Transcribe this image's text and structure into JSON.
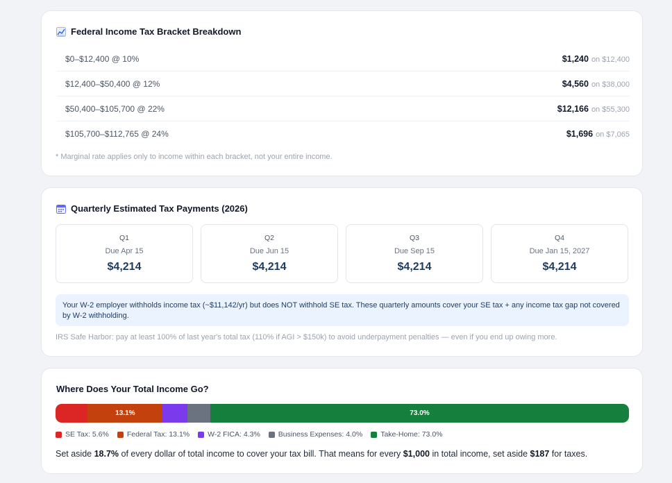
{
  "brackets": {
    "title": "Federal Income Tax Bracket Breakdown",
    "icon": "chart-icon",
    "rows": [
      {
        "range": "$0–$12,400 @ 10%",
        "tax": "$1,240",
        "on": "on $12,400"
      },
      {
        "range": "$12,400–$50,400 @ 12%",
        "tax": "$4,560",
        "on": "on $38,000"
      },
      {
        "range": "$50,400–$105,700 @ 22%",
        "tax": "$12,166",
        "on": "on $55,300"
      },
      {
        "range": "$105,700–$112,765 @ 24%",
        "tax": "$1,696",
        "on": "on $7,065"
      }
    ],
    "note": "* Marginal rate applies only to income within each bracket, not your entire income."
  },
  "quarterly": {
    "title": "Quarterly Estimated Tax Payments (2026)",
    "icon": "calendar-icon",
    "quarters": [
      {
        "label": "Q1",
        "due": "Due Apr 15",
        "amount": "$4,214"
      },
      {
        "label": "Q2",
        "due": "Due Jun 15",
        "amount": "$4,214"
      },
      {
        "label": "Q3",
        "due": "Due Sep 15",
        "amount": "$4,214"
      },
      {
        "label": "Q4",
        "due": "Due Jan 15, 2027",
        "amount": "$4,214"
      }
    ],
    "info": "Your W-2 employer withholds income tax (~$11,142/yr) but does NOT withhold SE tax. These quarterly amounts cover your SE tax + any income tax gap not covered by W-2 withholding.",
    "safe_harbor": "IRS Safe Harbor: pay at least 100% of last year's total tax (110% if AGI > $150k) to avoid underpayment penalties — even if you end up owing more."
  },
  "income": {
    "title": "Where Does Your Total Income Go?",
    "segments": [
      {
        "name": "SE Tax",
        "pct": 5.6,
        "color": "#dc2626",
        "bar_label": "",
        "legend": "SE Tax: 5.6%"
      },
      {
        "name": "Federal Tax",
        "pct": 13.1,
        "color": "#c2410c",
        "bar_label": "13.1%",
        "legend": "Federal Tax: 13.1%"
      },
      {
        "name": "W-2 FICA",
        "pct": 4.3,
        "color": "#7c3aed",
        "bar_label": "",
        "legend": "W-2 FICA: 4.3%"
      },
      {
        "name": "Business Expenses",
        "pct": 4.0,
        "color": "#6b7280",
        "bar_label": "",
        "legend": "Business Expenses: 4.0%"
      },
      {
        "name": "Take-Home",
        "pct": 73.0,
        "color": "#15803d",
        "bar_label": "73.0%",
        "legend": "Take-Home: 73.0%"
      }
    ],
    "summary": {
      "t1": "Set aside ",
      "pct": "18.7%",
      "t2": " of every dollar of total income to cover your tax bill. That means for every ",
      "per": "$1,000",
      "t3": " in total income, set aside ",
      "amt": "$187",
      "t4": " for taxes."
    }
  }
}
